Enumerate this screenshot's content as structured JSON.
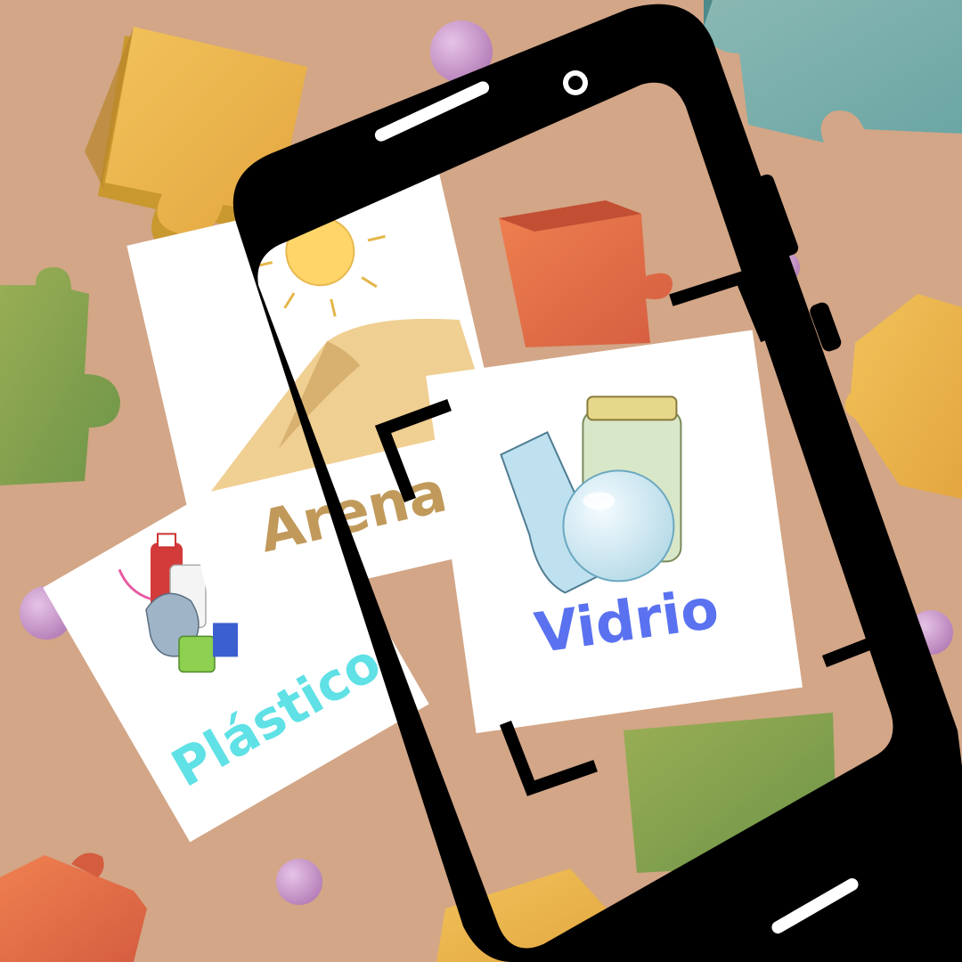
{
  "cards": {
    "arena": {
      "label": "Arena"
    },
    "plastico": {
      "label": "Plástico"
    },
    "vidrio": {
      "label": "Vidrio"
    }
  },
  "colors": {
    "background": "#d2a687",
    "arena_label": "#c19a5b",
    "plastico_label": "#5fe1e6",
    "vidrio_label": "#5a72f0",
    "phone_frame": "#000000",
    "card": "#ffffff"
  },
  "icons": {
    "sun": "sun-icon",
    "sand_dune": "sand-dune-icon",
    "plastic_waste": "plastic-waste-icon",
    "glass_items": "glass-items-icon",
    "puzzle_piece": "puzzle-piece-icon",
    "sphere": "sphere-icon"
  }
}
